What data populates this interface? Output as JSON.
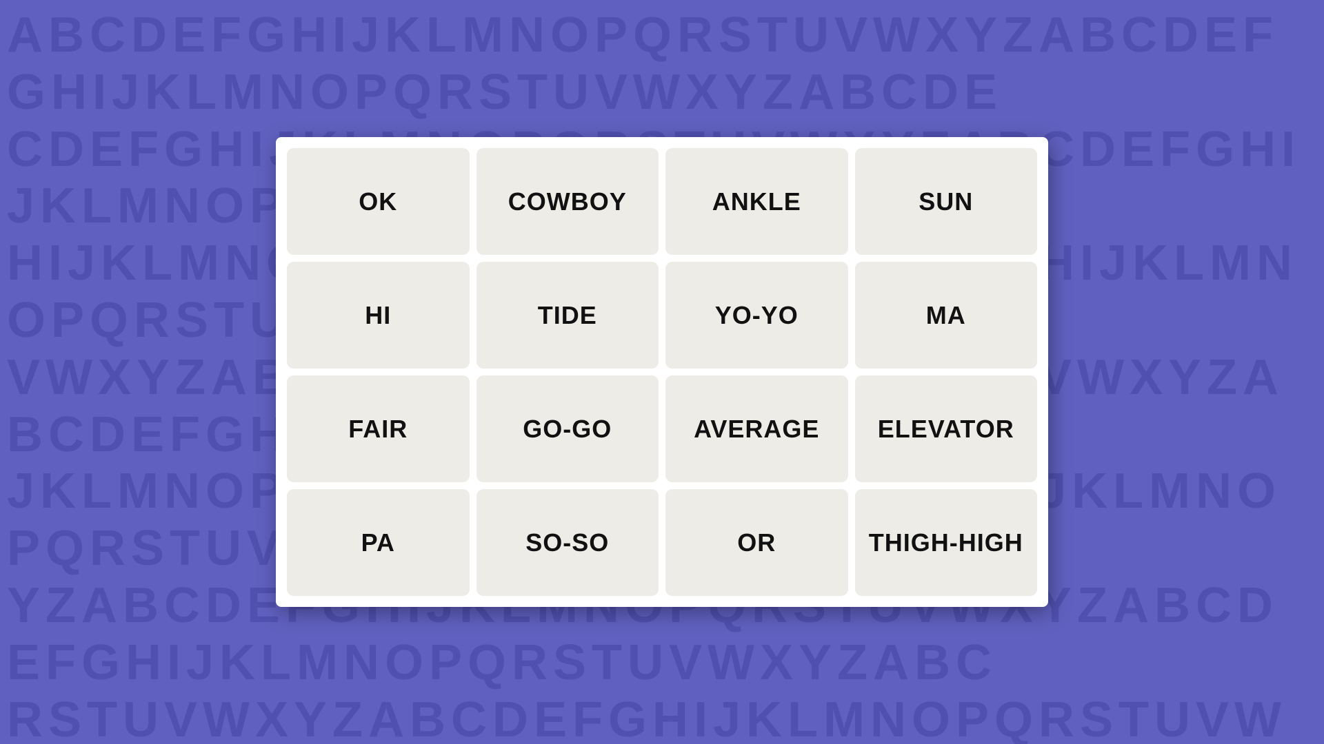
{
  "background": {
    "letters": "ABCDEFGHIJKLMNOPQRSTUVWXYZABCDEFGHIJKLMNOPQRSTUVWXYZABCDEFGHIJKLMNOPQRSTUVWXYZABCDEFGHIJKLMNOPQRSTUVWXYZABCDEFGHIJKLMNOPQRSTUVWXYZABCDEFGHIJKLMNOPQRSTUVWXYZABCDEFGHIJKLMNOPQRSTUVWXYZABCDEFGHIJKLMNOPQRSTUVWXYZABCDEFGHIJKLMNOPQRSTUVWXYZ"
  },
  "grid": {
    "cells": [
      {
        "id": "cell-ok",
        "label": "OK"
      },
      {
        "id": "cell-cowboy",
        "label": "COWBOY"
      },
      {
        "id": "cell-ankle",
        "label": "ANKLE"
      },
      {
        "id": "cell-sun",
        "label": "SUN"
      },
      {
        "id": "cell-hi",
        "label": "HI"
      },
      {
        "id": "cell-tide",
        "label": "TIDE"
      },
      {
        "id": "cell-yoyo",
        "label": "YO-YO"
      },
      {
        "id": "cell-ma",
        "label": "MA"
      },
      {
        "id": "cell-fair",
        "label": "FAIR"
      },
      {
        "id": "cell-gogo",
        "label": "GO-GO"
      },
      {
        "id": "cell-average",
        "label": "AVERAGE"
      },
      {
        "id": "cell-elevator",
        "label": "ELEVATOR"
      },
      {
        "id": "cell-pa",
        "label": "PA"
      },
      {
        "id": "cell-soso",
        "label": "SO-SO"
      },
      {
        "id": "cell-or",
        "label": "OR"
      },
      {
        "id": "cell-thighhigh",
        "label": "THIGH-HIGH"
      }
    ]
  }
}
